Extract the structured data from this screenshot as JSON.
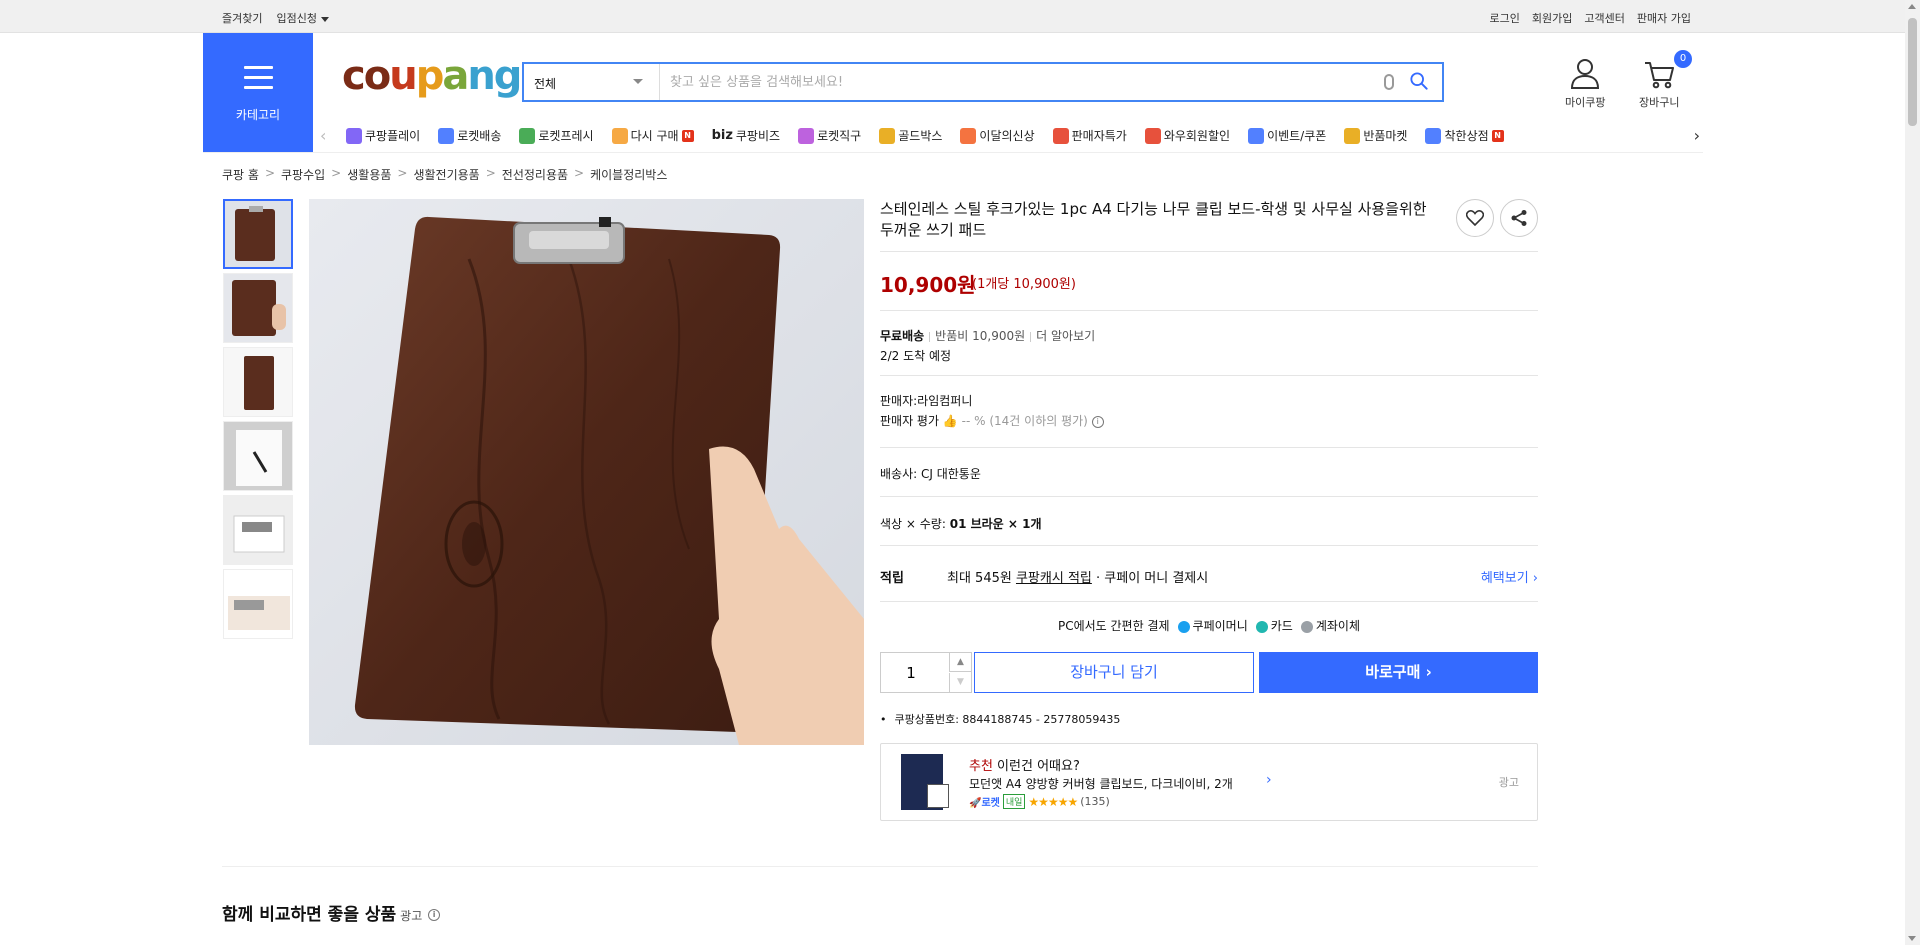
{
  "topbar": {
    "left": [
      "즐겨찾기",
      "입점신청"
    ],
    "right": [
      "로그인",
      "회원가입",
      "고객센터",
      "판매자 가입"
    ]
  },
  "header": {
    "category_label": "카테고리",
    "logo_text": "coupang",
    "search_scope": "전체",
    "search_placeholder": "찾고 싶은 상품을 검색해보세요!",
    "mycoupang_label": "마이쿠팡",
    "cart_label": "장바구니",
    "cart_count": "0"
  },
  "nav": {
    "items": [
      {
        "label": "쿠팡플레이",
        "icon": "play-icon",
        "color": "#6c4cf4"
      },
      {
        "label": "로켓배송",
        "icon": "rocket-icon",
        "color": "#346aff"
      },
      {
        "label": "로켓프레시",
        "icon": "rocket-fresh-icon",
        "color": "#2a9d3a"
      },
      {
        "label": "다시 구매",
        "icon": "repurchase-icon",
        "color": "#f59a23",
        "badge": "N"
      },
      {
        "label": "쿠팡비즈",
        "icon": "biz-icon",
        "color": "#222",
        "prefix": "biz"
      },
      {
        "label": "로켓직구",
        "icon": "global-icon",
        "color": "#b147d8"
      },
      {
        "label": "골드박스",
        "icon": "goldbox-icon",
        "color": "#e5a100"
      },
      {
        "label": "이달의신상",
        "icon": "new-icon",
        "color": "#f25a1e"
      },
      {
        "label": "판매자특가",
        "icon": "percent-icon",
        "color": "#e3321a"
      },
      {
        "label": "와우회원할인",
        "icon": "wow-icon",
        "color": "#e3321a"
      },
      {
        "label": "이벤트/쿠폰",
        "icon": "coupon-icon",
        "color": "#346aff"
      },
      {
        "label": "반품마켓",
        "icon": "return-market-icon",
        "color": "#e5a100"
      },
      {
        "label": "착한상점",
        "icon": "good-store-icon",
        "color": "#346aff",
        "badge": "N"
      }
    ]
  },
  "breadcrumb": [
    "쿠팡 홈",
    "쿠팡수입",
    "생활용품",
    "생활전기용품",
    "전선정리용품",
    "케이블정리박스"
  ],
  "product": {
    "title": "스테인레스 스틸 후크가있는 1pc A4 다기능 나무 클립 보드-학생 및 사무실 사용을위한 두꺼운 쓰기 패드",
    "price": "10,900원",
    "unit_price": "(1개당 10,900원)",
    "shipping_free": "무료배송",
    "return_fee": "반품비 10,900원",
    "learn_more": "더 알아보기",
    "arrival": "2/2 도착 예정",
    "seller": "판매자:라임컴퍼니",
    "seller_rating_label": "판매자 평가",
    "seller_rating_value": "-- %",
    "seller_rating_note": "(14건 이하의 평가)",
    "carrier": "배송사:  CJ 대한통운",
    "option_label": "색상 × 수량:",
    "option_value": "01 브라운 × 1개",
    "reward_label": "적립",
    "reward_prefix": "최대 545원",
    "reward_link": "쿠팡캐시 적립",
    "reward_suffix": "· 쿠페이 머니 결제시",
    "benefit_link": "혜택보기",
    "pay_intro": "PC에서도 간편한 결제",
    "pay_methods": [
      {
        "label": "쿠페이머니",
        "color": "#1aa0ef"
      },
      {
        "label": "카드",
        "color": "#21b7b0"
      },
      {
        "label": "계좌이체",
        "color": "#9aa0a6"
      }
    ],
    "quantity": "1",
    "add_to_cart": "장바구니 담기",
    "buy_now": "바로구매",
    "product_number": "쿠팡상품번호: 8844188745 - 25778059435"
  },
  "recommend": {
    "headline_red": "추천",
    "headline_rest": " 이런건 어때요?",
    "name": "모던앳 A4 양방향 커버형 클립보드, 다크네이비, 2개",
    "rocket": "로켓",
    "tomorrow": "내일",
    "stars": "★★★★★",
    "reviews": "(135)",
    "ad": "광고"
  },
  "section": {
    "title": "함께 비교하면 좋을 상품",
    "ad": "광고"
  },
  "colors": {
    "accent": "#346aff",
    "price": "#ae0000"
  }
}
